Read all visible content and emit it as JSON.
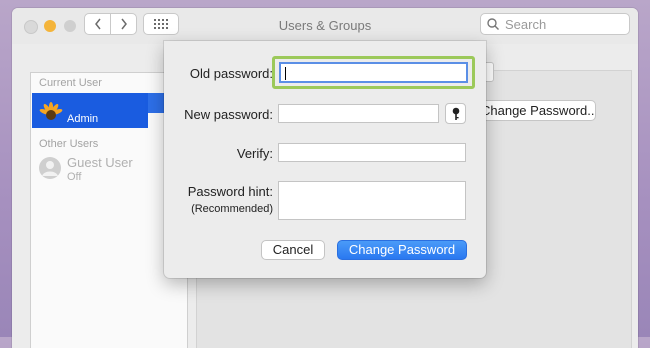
{
  "window": {
    "title": "Users & Groups"
  },
  "search": {
    "placeholder": "Search"
  },
  "sidebar": {
    "current_user_heading": "Current User",
    "current_user_role": "Admin",
    "other_users_heading": "Other Users",
    "guest_name": "Guest User",
    "guest_status": "Off"
  },
  "background": {
    "change_password_button": "Change Password..."
  },
  "dialog": {
    "old_password_label": "Old password:",
    "new_password_label": "New password:",
    "verify_label": "Verify:",
    "hint_label": "Password hint:",
    "hint_sublabel": "(Recommended)",
    "cancel_label": "Cancel",
    "change_label": "Change Password"
  },
  "colors": {
    "accent": "#2a78f0",
    "selection": "#1a5ce0",
    "focus_ring": "#9cc95a"
  }
}
